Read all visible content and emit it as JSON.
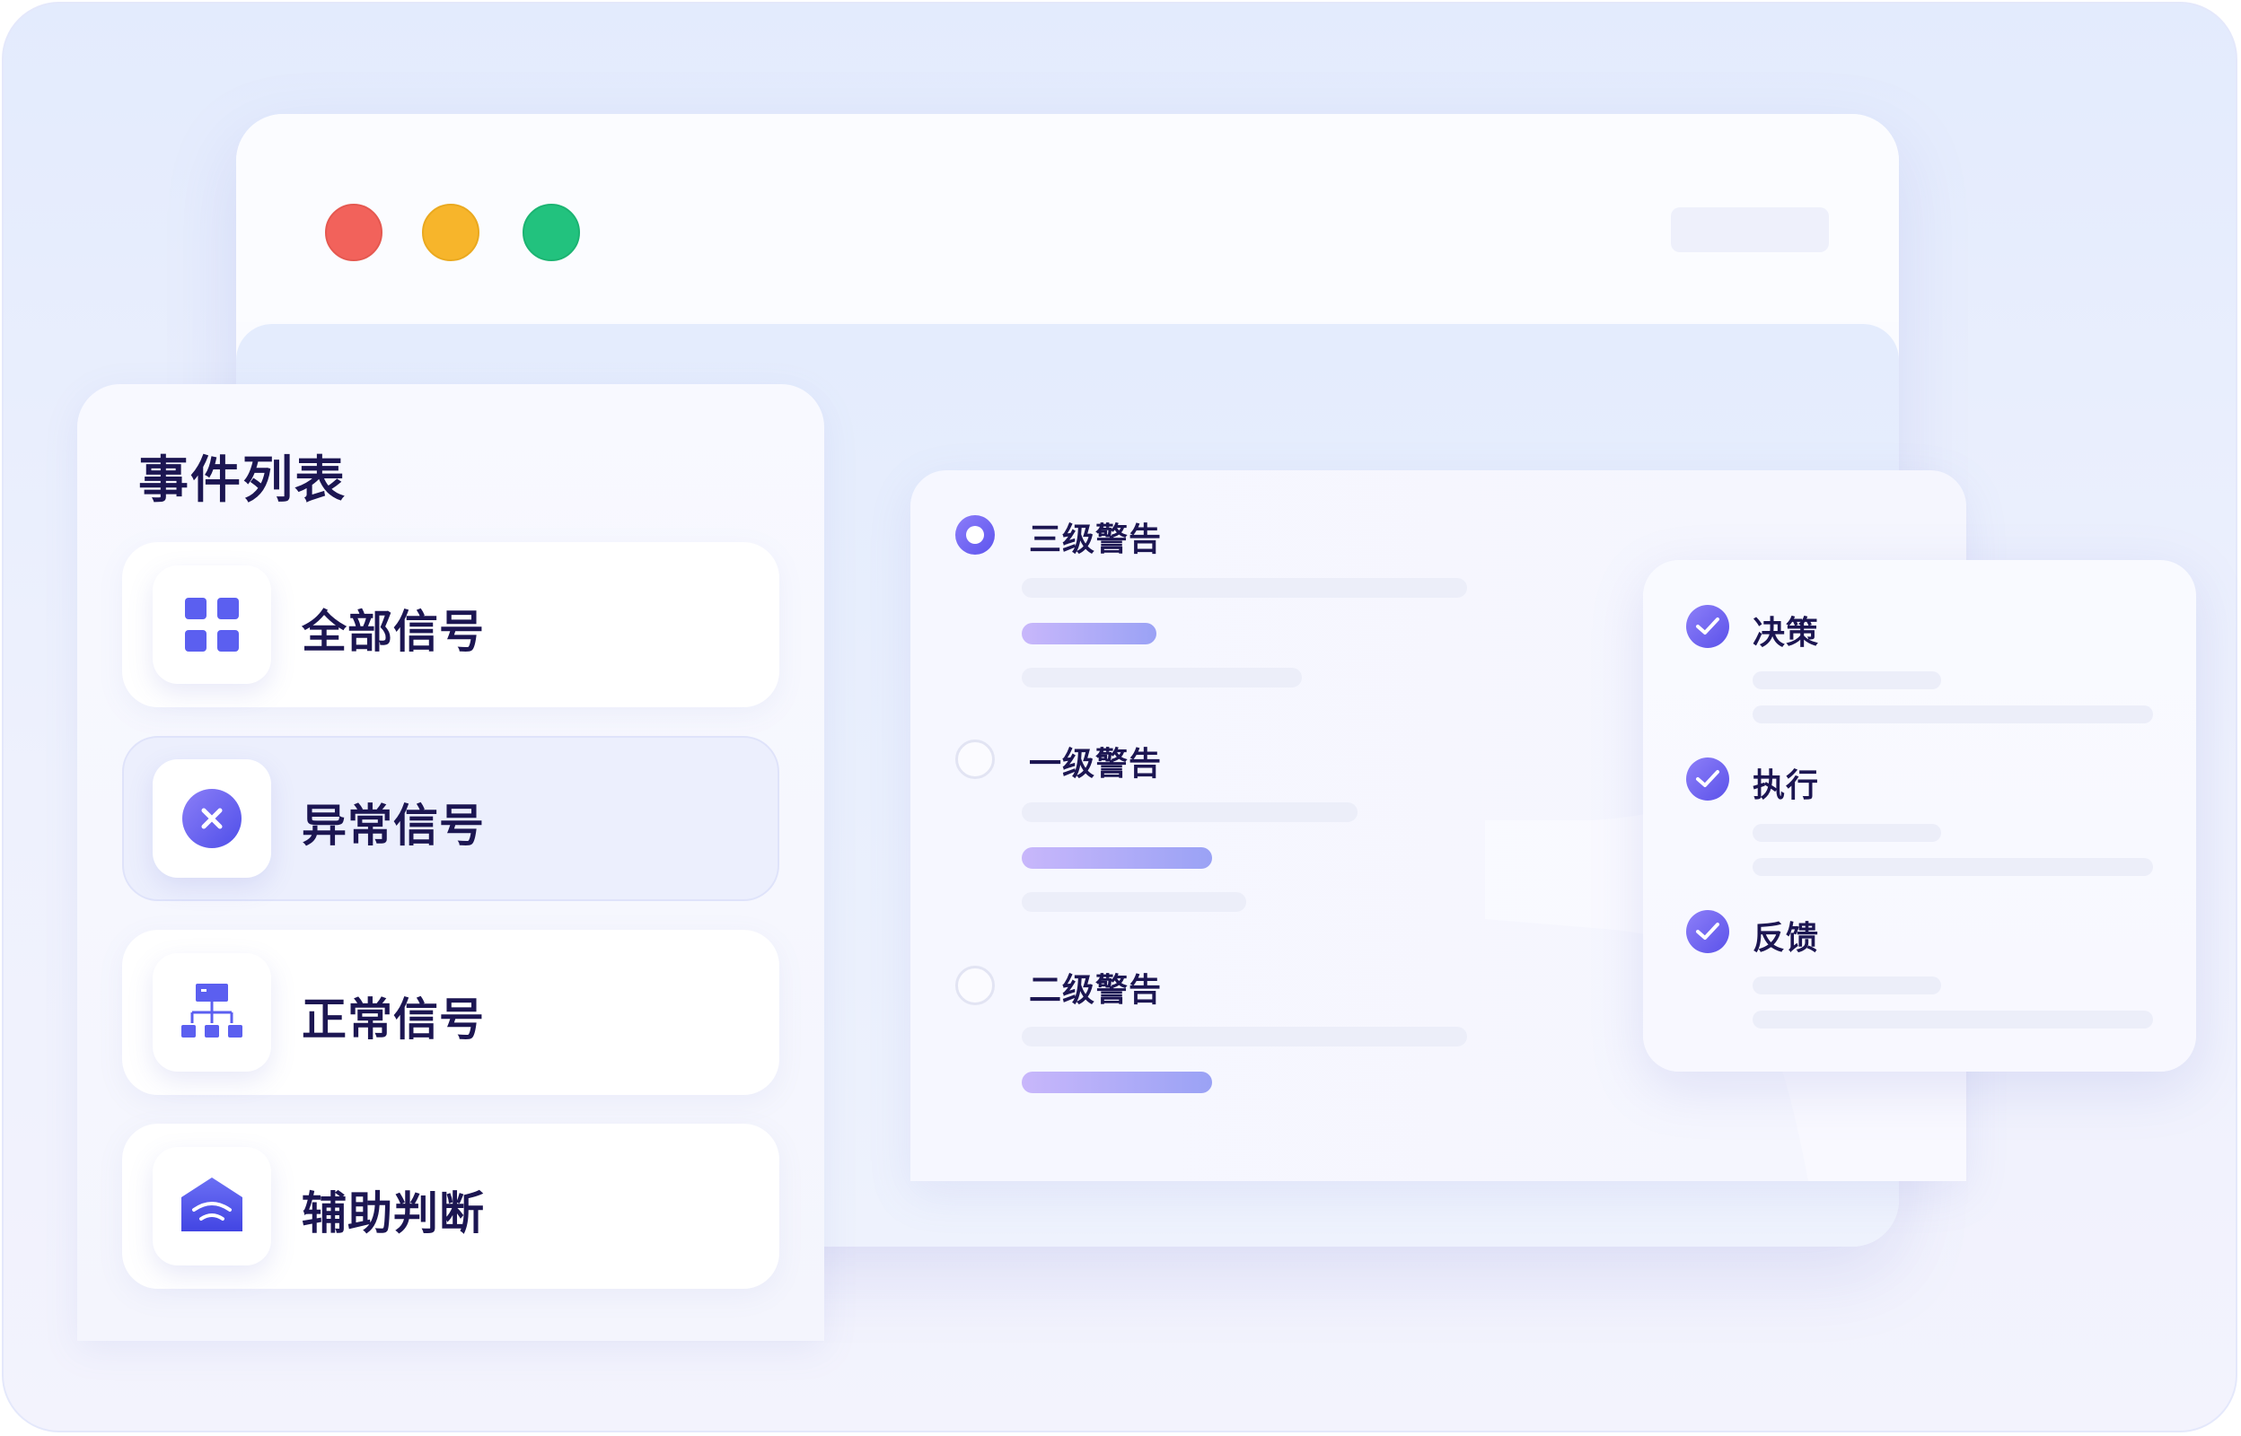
{
  "window": {
    "controls": [
      "close",
      "minimize",
      "maximize"
    ]
  },
  "event_panel": {
    "title": "事件列表",
    "items": [
      {
        "label": "全部信号",
        "icon": "grid-icon",
        "active": false
      },
      {
        "label": "异常信号",
        "icon": "close-circle-icon",
        "active": true
      },
      {
        "label": "正常信号",
        "icon": "hierarchy-icon",
        "active": false
      },
      {
        "label": "辅助判断",
        "icon": "signal-house-icon",
        "active": false
      }
    ]
  },
  "alert_panel": {
    "alerts": [
      {
        "label": "三级警告",
        "selected": true
      },
      {
        "label": "一级警告",
        "selected": false
      },
      {
        "label": "二级警告",
        "selected": false
      }
    ]
  },
  "steps_panel": {
    "steps": [
      {
        "label": "决策",
        "done": true
      },
      {
        "label": "执行",
        "done": true
      },
      {
        "label": "反馈",
        "done": true
      }
    ]
  },
  "colors": {
    "accent": "#5d55ee",
    "accent_light": "#8c7df9",
    "close": "#f2625b",
    "minimize": "#f7b52b",
    "maximize": "#22c27e",
    "title_text": "#1c1652"
  }
}
